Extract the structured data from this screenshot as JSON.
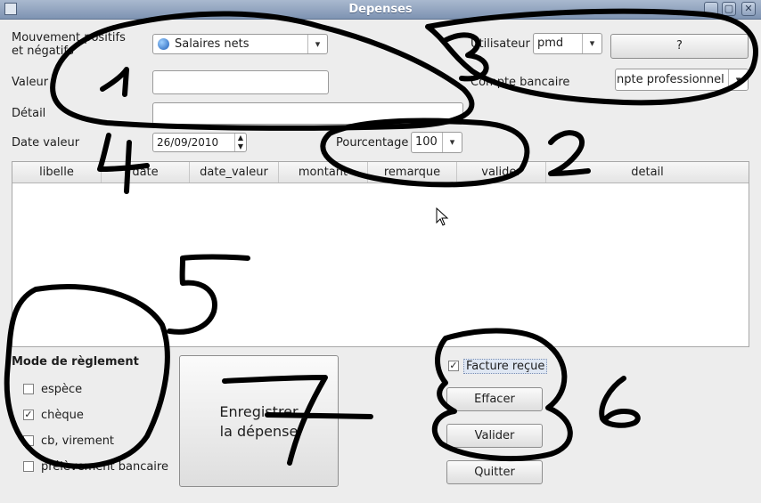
{
  "window": {
    "title": "Depenses",
    "buttons": [
      "_",
      "▢",
      "✕"
    ]
  },
  "form": {
    "mouvement_label_line1": "Mouvement positifs",
    "mouvement_label_line2": "et négatifs",
    "mouvement_value": "Salaires nets",
    "valeur_label": "Valeur",
    "valeur_value": "",
    "detail_label": "Détail",
    "detail_value": "",
    "date_label": "Date valeur",
    "date_value": "26/09/2010",
    "pourcentage_label": "Pourcentage",
    "pourcentage_value": "100",
    "utilisateur_label": "Utilisateur",
    "utilisateur_value": "pmd",
    "help_button": "?",
    "compte_label": "Compte bancaire",
    "compte_value": "npte professionnel"
  },
  "table": {
    "columns": [
      "libelle",
      "date",
      "date_valeur",
      "montant",
      "remarque",
      "valider",
      "detail"
    ],
    "rows": []
  },
  "reglement": {
    "title": "Mode de règlement",
    "options": [
      {
        "label": "espèce",
        "checked": false
      },
      {
        "label": "chèque",
        "checked": true
      },
      {
        "label": "cb, virement",
        "checked": false
      },
      {
        "label": "prélèvement bancaire",
        "checked": false
      }
    ]
  },
  "actions": {
    "save_line1": "Enregistrer",
    "save_line2": "la dépense",
    "facture_label": "Facture reçue",
    "facture_checked": true,
    "effacer": "Effacer",
    "valider": "Valider",
    "quitter": "Quitter"
  },
  "annotations": {
    "numbers": [
      "1",
      "2",
      "3",
      "4",
      "5",
      "6",
      "7"
    ],
    "stroke_color": "#000000"
  }
}
